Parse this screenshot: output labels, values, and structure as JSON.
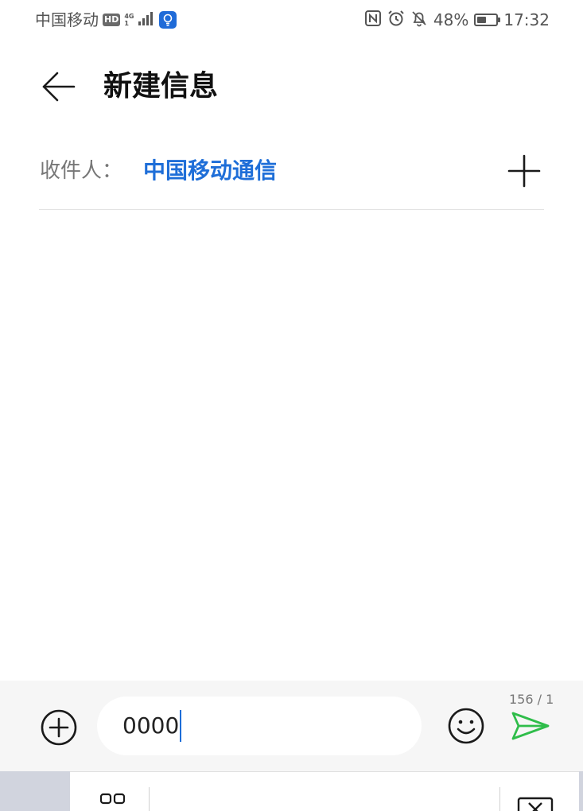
{
  "status_bar": {
    "carrier": "中国移动",
    "hd": "HD",
    "network_top": "4G",
    "network_bottom": "1",
    "battery_percent": "48%",
    "battery_level": 0.48,
    "time": "17:32",
    "icons": [
      "signal-icon",
      "lightbulb-icon",
      "nfc-icon",
      "alarm-icon",
      "bell-muted-icon",
      "battery-icon"
    ]
  },
  "header": {
    "back_icon": "back-arrow-icon",
    "title": "新建信息"
  },
  "recipient": {
    "label": "收件人：",
    "name": "中国移动通信",
    "add_icon": "plus-icon"
  },
  "composer": {
    "attach_icon": "plus-circle-icon",
    "message_text": "0000",
    "emoji_icon": "smiley-icon",
    "char_counter": "156 / 1",
    "send_icon": "send-icon",
    "colors": {
      "send": "#2fbd4a",
      "link": "#1e6ed8",
      "caret": "#1e6ed8"
    }
  },
  "keyboard": {
    "mode_icon": "keyboard-mode-icon",
    "delete_icon": "delete-icon"
  }
}
